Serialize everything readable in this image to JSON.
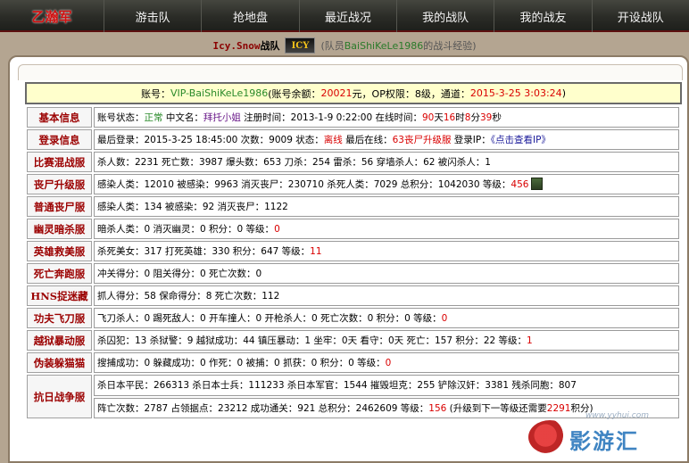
{
  "nav": {
    "logo": "乙瀚军",
    "items": [
      "游击队",
      "抢地盘",
      "最近战况",
      "我的战队",
      "我的战友",
      "开设战队"
    ]
  },
  "subheader": {
    "team_name": "Icy.Snow",
    "team_suffix": "战队",
    "badge": "ICY",
    "note_prefix": "(队员",
    "member": "BaiShiKeLe1986",
    "note_suffix": "的战斗经验)"
  },
  "account": {
    "label": "账号：",
    "id": "VIP-BaiShiKeLe1986",
    "balance_label": "(账号余额：",
    "balance": "20021",
    "balance_unit": "元，OP权限：8级，通道：",
    "expire": "2015-3-25 3:03:24",
    "close": ")"
  },
  "rows": [
    {
      "category": "基本信息",
      "line": [
        {
          "t": "账号状态："
        },
        {
          "t": "正常",
          "c": "green"
        },
        {
          "t": " 中文名："
        },
        {
          "t": "拜托小姐",
          "c": "purple"
        },
        {
          "t": " 注册时间：2013-1-9 0:22:00 在线时间："
        },
        {
          "t": "90",
          "c": "red"
        },
        {
          "t": "天"
        },
        {
          "t": "16",
          "c": "red"
        },
        {
          "t": "时"
        },
        {
          "t": "8",
          "c": "red"
        },
        {
          "t": "分"
        },
        {
          "t": "39",
          "c": "red"
        },
        {
          "t": "秒"
        }
      ]
    },
    {
      "category": "登录信息",
      "line": [
        {
          "t": "最后登录：2015-3-25 18:45:00 次数：9009 状态："
        },
        {
          "t": "离线",
          "c": "red"
        },
        {
          "t": " 最后在线："
        },
        {
          "t": "63丧尸升级服",
          "c": "red"
        },
        {
          "t": " 登录IP："
        },
        {
          "t": "《点击查看IP》",
          "c": "blue"
        }
      ]
    },
    {
      "category": "比赛混战服",
      "line": [
        {
          "t": "杀人数：2231 死亡数：3987 爆头数：653 刀杀：254 雷杀：56 穿墙杀人：62 被闪杀人：1"
        }
      ]
    },
    {
      "category": "丧尸升级服",
      "avatar": true,
      "line": [
        {
          "t": "感染人类：12010 被感染：9963 消灭丧尸：230710 杀死人类：7029 总积分：1042030 等级："
        },
        {
          "t": "456",
          "c": "red"
        }
      ]
    },
    {
      "category": "普通丧尸服",
      "line": [
        {
          "t": "感染人类：134 被感染：92 消灭丧尸：1122"
        }
      ]
    },
    {
      "category": "幽灵暗杀服",
      "line": [
        {
          "t": "暗杀人类：0 消灭幽灵：0 积分：0 等级："
        },
        {
          "t": "0",
          "c": "red"
        }
      ]
    },
    {
      "category": "英雄救美服",
      "line": [
        {
          "t": "杀死美女：317 打死英雄：330 积分：647 等级："
        },
        {
          "t": "11",
          "c": "red"
        }
      ]
    },
    {
      "category": "死亡奔跑服",
      "line": [
        {
          "t": "冲关得分：0 阻关得分：0 死亡次数：0"
        }
      ]
    },
    {
      "category": "HNS捉迷藏",
      "line": [
        {
          "t": "抓人得分：58 保命得分：8 死亡次数：112"
        }
      ]
    },
    {
      "category": "功夫飞刀服",
      "line": [
        {
          "t": "飞刀杀人：0 踢死敌人：0 开车撞人：0 开枪杀人：0 死亡次数：0 积分：0 等级："
        },
        {
          "t": "0",
          "c": "red"
        }
      ]
    },
    {
      "category": "越狱暴动服",
      "line": [
        {
          "t": "杀囚犯：13 杀狱警：9 越狱成功：44 镇压暴动：1 坐牢：0天 看守：0天 死亡：157 积分：22 等级："
        },
        {
          "t": "1",
          "c": "red"
        }
      ]
    },
    {
      "category": "伪装躲猫猫",
      "line": [
        {
          "t": "搜捕成功：0 躲藏成功：0 作死：0 被捕：0 抓获：0 积分：0 等级："
        },
        {
          "t": "0",
          "c": "red"
        }
      ]
    }
  ],
  "anti_japan": {
    "category": "抗日战争服",
    "line1": "杀日本平民：266313 杀日本士兵：111233 杀日本军官：1544 摧毁坦克：255 铲除汉奸：3381 残杀同胞：807",
    "line2": [
      {
        "t": "阵亡次数：2787 占领据点：23212 成功通关：921 总积分：2462609 等级："
      },
      {
        "t": "156",
        "c": "red"
      },
      {
        "t": " (升级到下一等级还需要"
      },
      {
        "t": "2291",
        "c": "red"
      },
      {
        "t": "积分)"
      }
    ]
  },
  "watermark": {
    "text": "影游汇",
    "url": "www.yyhui.com"
  }
}
